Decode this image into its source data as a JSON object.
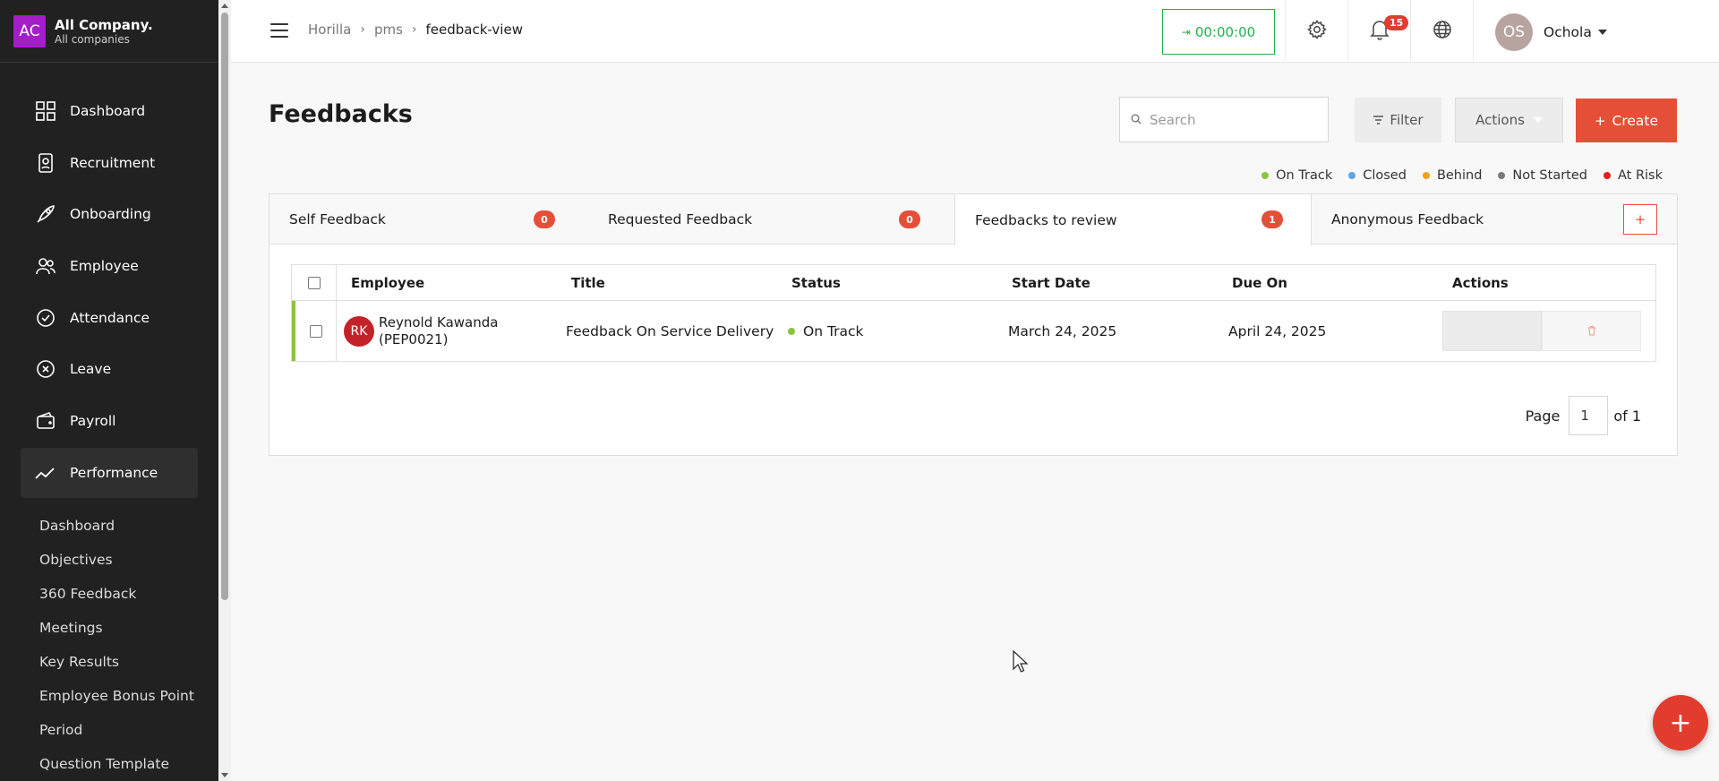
{
  "company": {
    "logo": "AC",
    "name": "All Company.",
    "subtitle": "All companies"
  },
  "sidebar": {
    "items": [
      {
        "label": "Dashboard",
        "icon": "dashboard-icon"
      },
      {
        "label": "Recruitment",
        "icon": "recruitment-icon"
      },
      {
        "label": "Onboarding",
        "icon": "rocket-icon"
      },
      {
        "label": "Employee",
        "icon": "users-icon"
      },
      {
        "label": "Attendance",
        "icon": "check-circle-icon"
      },
      {
        "label": "Leave",
        "icon": "x-circle-icon"
      },
      {
        "label": "Payroll",
        "icon": "wallet-icon"
      },
      {
        "label": "Performance",
        "icon": "trend-icon",
        "active": true
      }
    ],
    "subitems": [
      "Dashboard",
      "Objectives",
      "360 Feedback",
      "Meetings",
      "Key Results",
      "Employee Bonus Point",
      "Period",
      "Question Template"
    ]
  },
  "header": {
    "breadcrumb": [
      "Horilla",
      "pms",
      "feedback-view"
    ],
    "timer": "00:00:00",
    "notification_count": "15",
    "user_initials": "OS",
    "user_name": "Ochola"
  },
  "page": {
    "title": "Feedbacks",
    "search_placeholder": "Search",
    "filter_label": "Filter",
    "actions_label": "Actions",
    "create_label": "Create"
  },
  "legend": [
    {
      "label": "On Track",
      "color": "#8ac43f"
    },
    {
      "label": "Closed",
      "color": "#5aa6e8"
    },
    {
      "label": "Behind",
      "color": "#f0a21d"
    },
    {
      "label": "Not Started",
      "color": "#7a7a7a"
    },
    {
      "label": "At Risk",
      "color": "#e0201e"
    }
  ],
  "tabs": [
    {
      "label": "Self Feedback",
      "count": "0"
    },
    {
      "label": "Requested Feedback",
      "count": "0"
    },
    {
      "label": "Feedbacks to review",
      "count": "1"
    },
    {
      "label": "Anonymous Feedback"
    }
  ],
  "table": {
    "headers": [
      "Employee",
      "Title",
      "Status",
      "Start Date",
      "Due On",
      "Actions"
    ],
    "rows": [
      {
        "initials": "RK",
        "employee": "Reynold Kawanda (PEP0021)",
        "title": "Feedback On Service Delivery",
        "status": "On Track",
        "start_date": "March 24, 2025",
        "due_on": "April 24, 2025"
      }
    ]
  },
  "pager": {
    "label": "Page",
    "current": "1",
    "of": "of 1"
  },
  "fab": "+"
}
